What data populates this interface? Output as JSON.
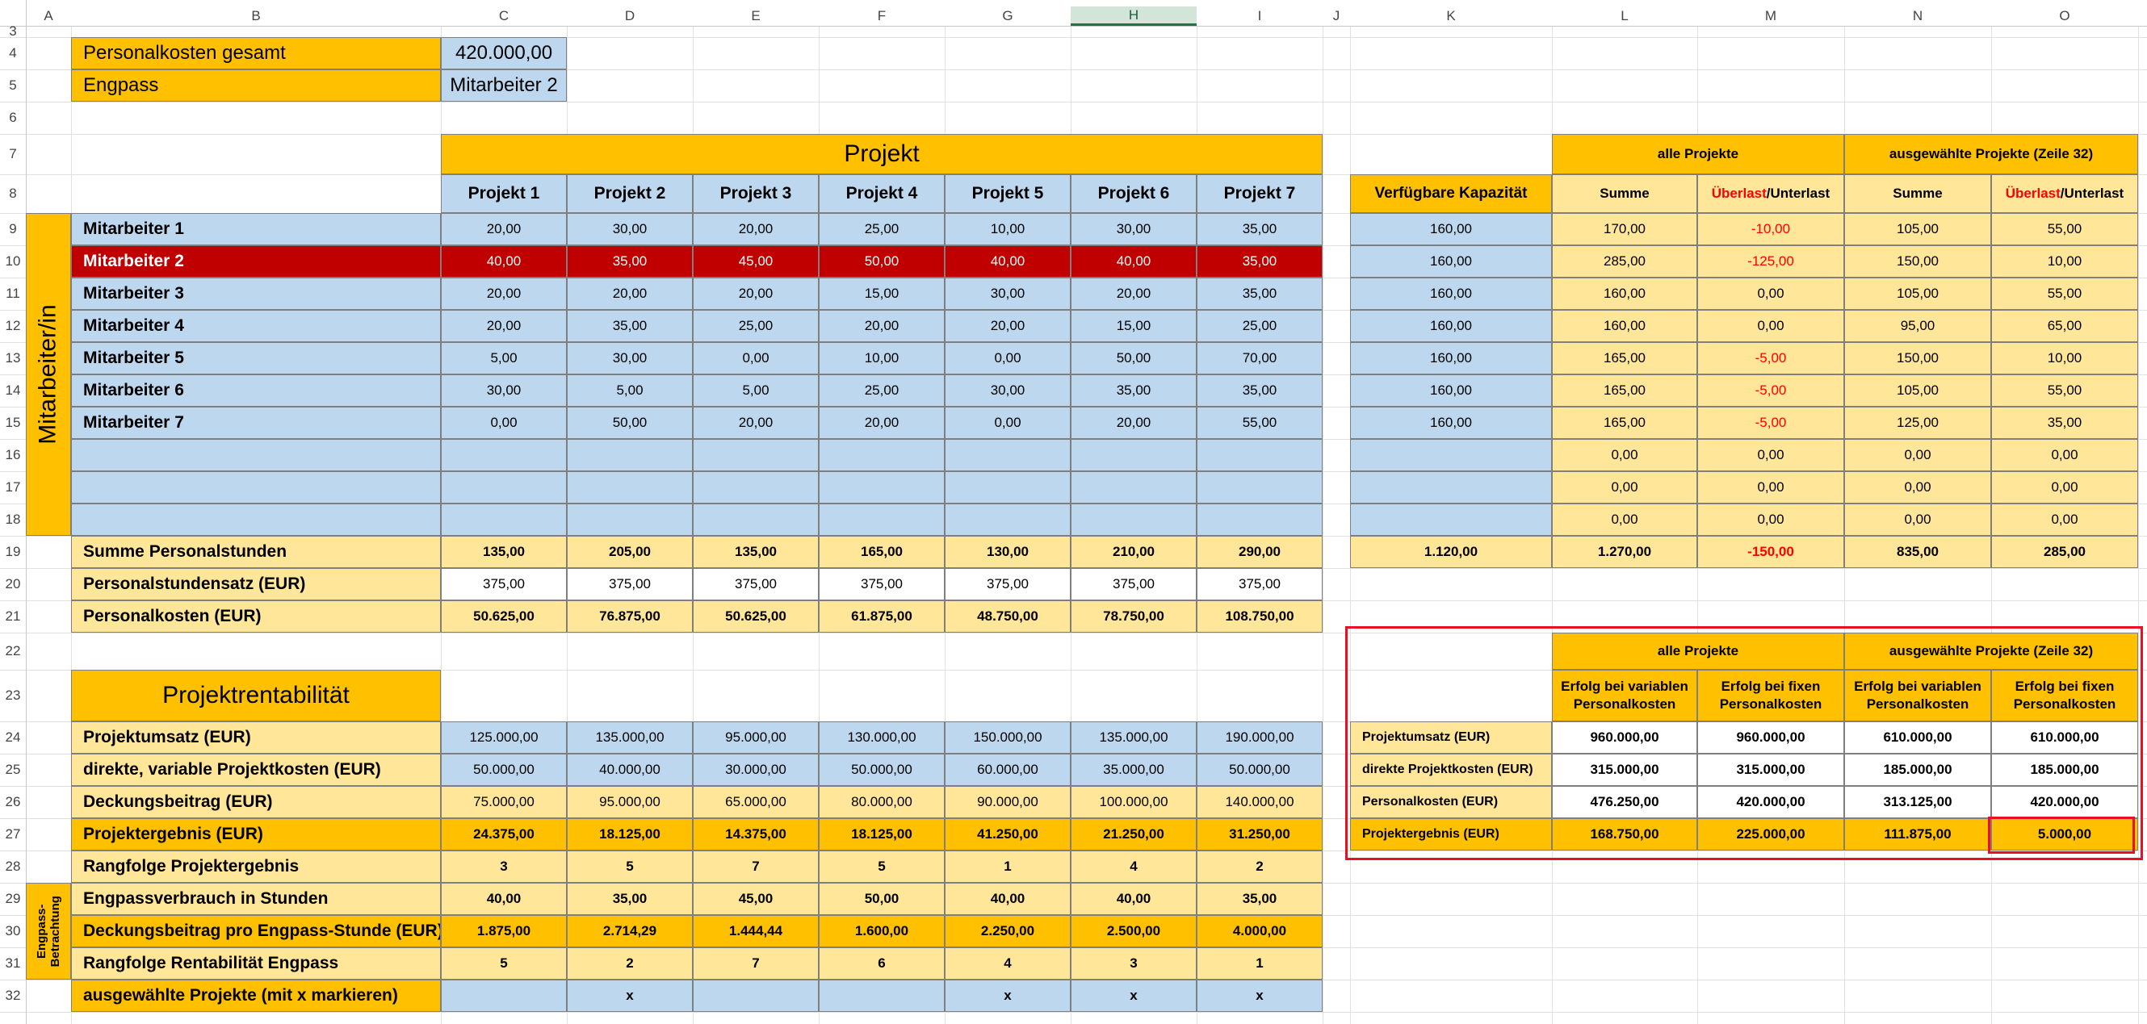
{
  "columns": [
    "A",
    "B",
    "C",
    "D",
    "E",
    "F",
    "G",
    "H",
    "I",
    "J",
    "K",
    "L",
    "M",
    "N",
    "O"
  ],
  "selected_column": "H",
  "rows": [
    "3",
    "4",
    "5",
    "6",
    "7",
    "8",
    "9",
    "10",
    "11",
    "12",
    "13",
    "14",
    "15",
    "16",
    "17",
    "18",
    "19",
    "20",
    "21",
    "22",
    "23",
    "24",
    "25",
    "26",
    "27",
    "28",
    "29",
    "30",
    "31",
    "32"
  ],
  "colors": {
    "orange": "#FFC000",
    "light_orange": "#FFE699",
    "light_blue": "#BDD7EE",
    "red_fill": "#C00000",
    "red_text": "#FF0000",
    "highlight_border": "#E81123",
    "gridline": "#E1E1E1"
  },
  "top": {
    "personalkosten_label": "Personalkosten gesamt",
    "personalkosten_value": "420.000,00",
    "engpass_label": "Engpass",
    "engpass_value": "Mitarbeiter 2"
  },
  "projekt_header": "Projekt",
  "projects": [
    "Projekt 1",
    "Projekt 2",
    "Projekt 3",
    "Projekt 4",
    "Projekt 5",
    "Projekt 6",
    "Projekt 7"
  ],
  "mitarbeiter_label": "Mitarbeiter/in",
  "employees": [
    {
      "name": "Mitarbeiter 1",
      "hours": [
        "20,00",
        "30,00",
        "20,00",
        "25,00",
        "10,00",
        "30,00",
        "35,00"
      ]
    },
    {
      "name": "Mitarbeiter 2",
      "hours": [
        "40,00",
        "35,00",
        "45,00",
        "50,00",
        "40,00",
        "40,00",
        "35,00"
      ]
    },
    {
      "name": "Mitarbeiter 3",
      "hours": [
        "20,00",
        "20,00",
        "20,00",
        "15,00",
        "30,00",
        "20,00",
        "35,00"
      ]
    },
    {
      "name": "Mitarbeiter 4",
      "hours": [
        "20,00",
        "35,00",
        "25,00",
        "20,00",
        "20,00",
        "15,00",
        "25,00"
      ]
    },
    {
      "name": "Mitarbeiter 5",
      "hours": [
        "5,00",
        "30,00",
        "0,00",
        "10,00",
        "0,00",
        "50,00",
        "70,00"
      ]
    },
    {
      "name": "Mitarbeiter 6",
      "hours": [
        "30,00",
        "5,00",
        "5,00",
        "25,00",
        "30,00",
        "35,00",
        "35,00"
      ]
    },
    {
      "name": "Mitarbeiter 7",
      "hours": [
        "0,00",
        "50,00",
        "20,00",
        "20,00",
        "0,00",
        "20,00",
        "55,00"
      ]
    }
  ],
  "summary_rows": [
    {
      "label": "Summe Personalstunden",
      "values": [
        "135,00",
        "205,00",
        "135,00",
        "165,00",
        "130,00",
        "210,00",
        "290,00"
      ]
    },
    {
      "label": "Personalstundensatz (EUR)",
      "values": [
        "375,00",
        "375,00",
        "375,00",
        "375,00",
        "375,00",
        "375,00",
        "375,00"
      ]
    },
    {
      "label": "Personalkosten (EUR)",
      "values": [
        "50.625,00",
        "76.875,00",
        "50.625,00",
        "61.875,00",
        "48.750,00",
        "78.750,00",
        "108.750,00"
      ]
    }
  ],
  "rentabilitaet_header": "Projektrentabilität",
  "rentabilitaet_rows": [
    {
      "label": "Projektumsatz (EUR)",
      "values": [
        "125.000,00",
        "135.000,00",
        "95.000,00",
        "130.000,00",
        "150.000,00",
        "135.000,00",
        "190.000,00"
      ]
    },
    {
      "label": "direkte, variable Projektkosten (EUR)",
      "values": [
        "50.000,00",
        "40.000,00",
        "30.000,00",
        "50.000,00",
        "60.000,00",
        "35.000,00",
        "50.000,00"
      ]
    },
    {
      "label": "Deckungsbeitrag (EUR)",
      "values": [
        "75.000,00",
        "95.000,00",
        "65.000,00",
        "80.000,00",
        "90.000,00",
        "100.000,00",
        "140.000,00"
      ]
    },
    {
      "label": "Projektergebnis (EUR)",
      "values": [
        "24.375,00",
        "18.125,00",
        "14.375,00",
        "18.125,00",
        "41.250,00",
        "21.250,00",
        "31.250,00"
      ]
    },
    {
      "label": "Rangfolge Projektergebnis",
      "values": [
        "3",
        "5",
        "7",
        "5",
        "1",
        "4",
        "2"
      ]
    }
  ],
  "engpass_label": "Engpass-\nBetrachtung",
  "engpass_rows": [
    {
      "label": "Engpassverbrauch in Stunden",
      "values": [
        "40,00",
        "35,00",
        "45,00",
        "50,00",
        "40,00",
        "40,00",
        "35,00"
      ]
    },
    {
      "label": "Deckungsbeitrag pro Engpass-Stunde (EUR)",
      "values": [
        "1.875,00",
        "2.714,29",
        "1.444,44",
        "1.600,00",
        "2.250,00",
        "2.500,00",
        "4.000,00"
      ]
    },
    {
      "label": "Rangfolge Rentabilität Engpass",
      "values": [
        "5",
        "2",
        "7",
        "6",
        "4",
        "3",
        "1"
      ]
    },
    {
      "label": "ausgewählte Projekte (mit x markieren)",
      "values": [
        "",
        "x",
        "",
        "",
        "x",
        "x",
        "x"
      ]
    }
  ],
  "capacity": {
    "header_alle": "alle Projekte",
    "header_ausgewaehlt": "ausgewählte Projekte (Zeile 32)",
    "verfuegbar_label": "Verfügbare Kapazität",
    "summe_label": "Summe",
    "ueberlast_label": "Überlast",
    "unterlast_label": "/Unterlast",
    "rows": [
      [
        "160,00",
        "170,00",
        "-10,00",
        "105,00",
        "55,00"
      ],
      [
        "160,00",
        "285,00",
        "-125,00",
        "150,00",
        "10,00"
      ],
      [
        "160,00",
        "160,00",
        "0,00",
        "105,00",
        "55,00"
      ],
      [
        "160,00",
        "160,00",
        "0,00",
        "95,00",
        "65,00"
      ],
      [
        "160,00",
        "165,00",
        "-5,00",
        "150,00",
        "10,00"
      ],
      [
        "160,00",
        "165,00",
        "-5,00",
        "105,00",
        "55,00"
      ],
      [
        "160,00",
        "165,00",
        "-5,00",
        "125,00",
        "35,00"
      ],
      [
        "",
        "0,00",
        "0,00",
        "0,00",
        "0,00"
      ],
      [
        "",
        "0,00",
        "0,00",
        "0,00",
        "0,00"
      ],
      [
        "",
        "0,00",
        "0,00",
        "0,00",
        "0,00"
      ]
    ],
    "totals": [
      "1.120,00",
      "1.270,00",
      "-150,00",
      "835,00",
      "285,00"
    ]
  },
  "result": {
    "header_alle": "alle Projekte",
    "header_ausgewaehlt": "ausgewählte Projekte (Zeile 32)",
    "sub_headers": [
      "Erfolg bei variablen\nPersonalkosten",
      "Erfolg bei fixen\nPersonalkosten",
      "Erfolg bei variablen\nPersonalkosten",
      "Erfolg bei fixen\nPersonalkosten"
    ],
    "rows": [
      {
        "label": "Projektumsatz (EUR)",
        "values": [
          "960.000,00",
          "960.000,00",
          "610.000,00",
          "610.000,00"
        ]
      },
      {
        "label": "direkte Projektkosten (EUR)",
        "values": [
          "315.000,00",
          "315.000,00",
          "185.000,00",
          "185.000,00"
        ]
      },
      {
        "label": "Personalkosten (EUR)",
        "values": [
          "476.250,00",
          "420.000,00",
          "313.125,00",
          "420.000,00"
        ]
      },
      {
        "label": "Projektergebnis (EUR)",
        "values": [
          "168.750,00",
          "225.000,00",
          "111.875,00",
          "5.000,00"
        ]
      }
    ]
  }
}
